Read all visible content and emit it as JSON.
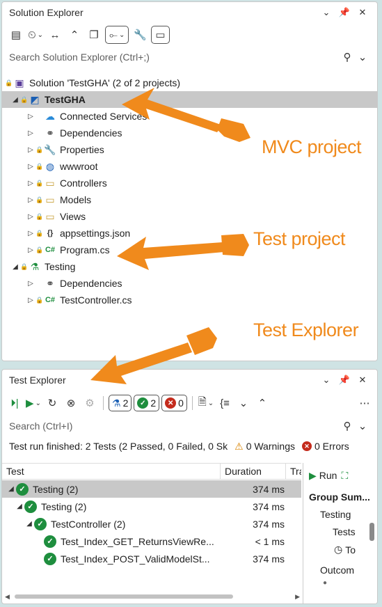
{
  "solution_explorer": {
    "title": "Solution Explorer",
    "search_placeholder": "Search Solution Explorer (Ctrl+;)",
    "solution_label": "Solution 'TestGHA' (2 of 2 projects)",
    "tree": [
      {
        "label": "TestGHA",
        "icon": "web-project-icon",
        "level": 1,
        "expanded": true,
        "selected": true,
        "bold": true
      },
      {
        "label": "Connected Services",
        "icon": "cloud-icon",
        "level": 2
      },
      {
        "label": "Dependencies",
        "icon": "dependencies-icon",
        "level": 2
      },
      {
        "label": "Properties",
        "icon": "wrench-icon",
        "level": 2,
        "lock": true
      },
      {
        "label": "wwwroot",
        "icon": "globe-icon",
        "level": 2,
        "lock": true
      },
      {
        "label": "Controllers",
        "icon": "folder-icon",
        "level": 2,
        "lock": true
      },
      {
        "label": "Models",
        "icon": "folder-icon",
        "level": 2,
        "lock": true
      },
      {
        "label": "Views",
        "icon": "folder-icon",
        "level": 2,
        "lock": true
      },
      {
        "label": "appsettings.json",
        "icon": "json-icon",
        "level": 2,
        "lock": true
      },
      {
        "label": "Program.cs",
        "icon": "csharp-icon",
        "level": 2,
        "lock": true
      },
      {
        "label": "Testing",
        "icon": "test-project-icon",
        "level": 1,
        "expanded": true
      },
      {
        "label": "Dependencies",
        "icon": "dependencies-icon",
        "level": 2
      },
      {
        "label": "TestController.cs",
        "icon": "csharp-icon",
        "level": 2,
        "lock": true
      }
    ]
  },
  "annotations": {
    "mvc": "MVC project",
    "test_project": "Test project",
    "test_explorer": "Test Explorer",
    "color": "#f08a1c"
  },
  "test_explorer": {
    "title": "Test Explorer",
    "search_placeholder": "Search (Ctrl+I)",
    "counts": {
      "total": "2",
      "passed": "2",
      "failed": "0"
    },
    "status_text": "Test run finished: 2 Tests (2 Passed, 0 Failed, 0 Sk",
    "warnings": "0 Warnings",
    "errors": "0 Errors",
    "columns": {
      "test": "Test",
      "duration": "Duration",
      "traits": "Tra"
    },
    "rows": [
      {
        "name": "Testing  (2)",
        "duration": "374 ms",
        "level": 0,
        "selected": true
      },
      {
        "name": "Testing  (2)",
        "duration": "374 ms",
        "level": 1
      },
      {
        "name": "TestController  (2)",
        "duration": "374 ms",
        "level": 2
      },
      {
        "name": "Test_Index_GET_ReturnsViewRe...",
        "duration": "< 1 ms",
        "level": 3
      },
      {
        "name": "Test_Index_POST_ValidModelSt...",
        "duration": "374 ms",
        "level": 3
      }
    ],
    "side": {
      "run": "Run",
      "group_summary": "Group Sum...",
      "testing": "Testing",
      "tests": "Tests",
      "to": "To",
      "outcome": "Outcom"
    }
  }
}
